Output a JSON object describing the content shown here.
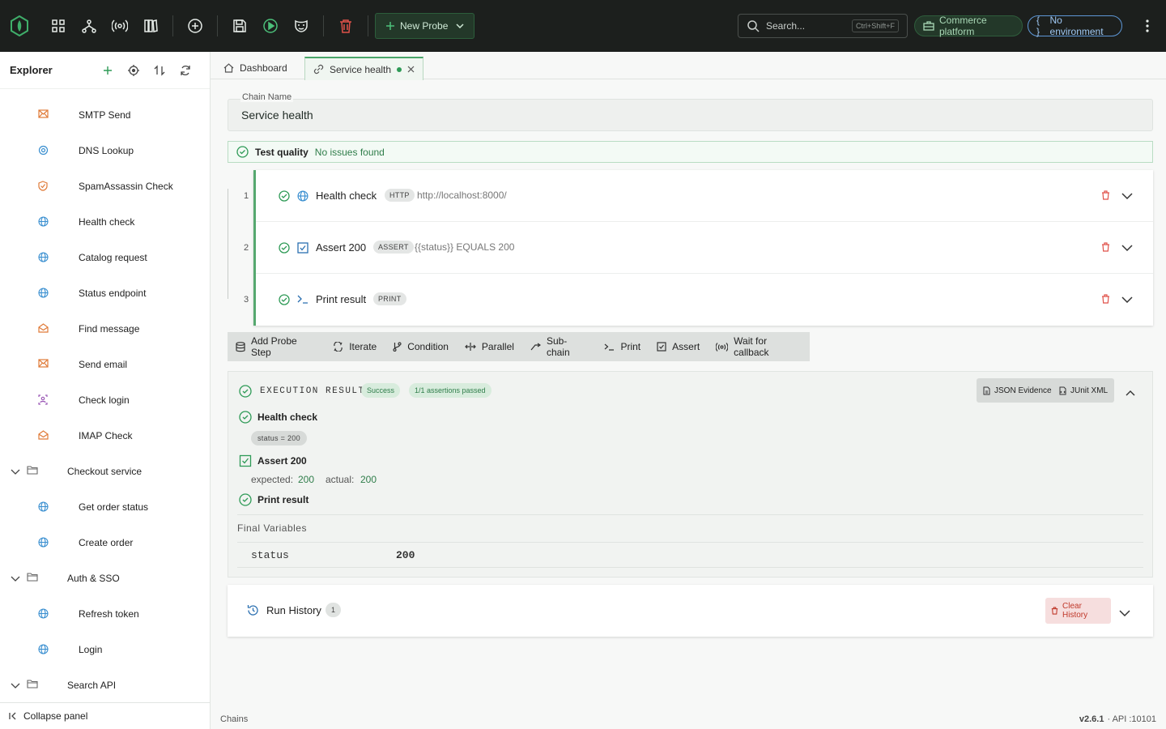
{
  "header": {
    "new_probe_label": "New Probe",
    "search_placeholder": "Search...",
    "search_shortcut": "Ctrl+Shift+F",
    "workspace": "Commerce platform",
    "environment": "No environment"
  },
  "sidebar": {
    "title": "Explorer",
    "items": [
      {
        "label": "SMTP Send",
        "icon": "mail-icon",
        "color": "#e07b39"
      },
      {
        "label": "DNS Lookup",
        "icon": "dns-icon",
        "color": "#3a8fd0"
      },
      {
        "label": "SpamAssassin Check",
        "icon": "shield-icon",
        "color": "#e07b39"
      },
      {
        "label": "Health check",
        "icon": "globe-icon",
        "color": "#3a8fd0"
      },
      {
        "label": "Catalog request",
        "icon": "globe-icon",
        "color": "#3a8fd0"
      },
      {
        "label": "Status endpoint",
        "icon": "globe-icon",
        "color": "#3a8fd0"
      },
      {
        "label": "Find message",
        "icon": "mail-open-icon",
        "color": "#e07b39"
      },
      {
        "label": "Send email",
        "icon": "mail-icon",
        "color": "#e07b39"
      },
      {
        "label": "Check login",
        "icon": "id-card-icon",
        "color": "#9b59b6"
      },
      {
        "label": "IMAP Check",
        "icon": "mail-open-icon",
        "color": "#e07b39"
      },
      {
        "label": "Checkout service",
        "folder": true
      },
      {
        "label": "Get order status",
        "icon": "globe-icon",
        "color": "#3a8fd0"
      },
      {
        "label": "Create order",
        "icon": "globe-icon",
        "color": "#3a8fd0"
      },
      {
        "label": "Auth & SSO",
        "folder": true
      },
      {
        "label": "Refresh token",
        "icon": "globe-icon",
        "color": "#3a8fd0"
      },
      {
        "label": "Login",
        "icon": "globe-icon",
        "color": "#3a8fd0"
      },
      {
        "label": "Search API",
        "folder": true
      }
    ],
    "collapse_label": "Collapse panel"
  },
  "tabs": [
    {
      "label": "Dashboard"
    },
    {
      "label": "Service health"
    }
  ],
  "chain": {
    "name_label": "Chain Name",
    "name_value": "Service health",
    "quality_title": "Test quality",
    "quality_status": "No issues found"
  },
  "steps": [
    {
      "num": "1",
      "name": "Health check",
      "badge": "HTTP",
      "detail": "http://localhost:8000/"
    },
    {
      "num": "2",
      "name": "Assert 200",
      "badge": "ASSERT",
      "detail": "{{status}} EQUALS 200"
    },
    {
      "num": "3",
      "name": "Print result",
      "badge": "PRINT",
      "detail": ""
    }
  ],
  "toolbar": [
    "Add Probe Step",
    "Iterate",
    "Condition",
    "Parallel",
    "Sub-chain",
    "Print",
    "Assert",
    "Wait for callback"
  ],
  "results": {
    "title": "EXECUTION RESULTS",
    "status_badge": "Success",
    "assertions_badge": "1/1 assertions passed",
    "json_label": "JSON Evidence",
    "junit_label": "JUnit XML",
    "item1": "Health check",
    "item1_var": "status = 200",
    "item2": "Assert 200",
    "expected_label": "expected:",
    "expected_value": "200",
    "actual_label": "actual:",
    "actual_value": "200",
    "item3": "Print result",
    "final_vars_title": "Final Variables",
    "var_name": "status",
    "var_value": "200"
  },
  "history": {
    "title": "Run History",
    "count": "1",
    "clear_label": "Clear History"
  },
  "footer": {
    "section": "Chains",
    "version": "v2.6.1",
    "api": "· API :10101"
  },
  "colors": {
    "accent": "#2e9a56",
    "topbar": "#1c1f1d",
    "danger": "#c0392b"
  }
}
